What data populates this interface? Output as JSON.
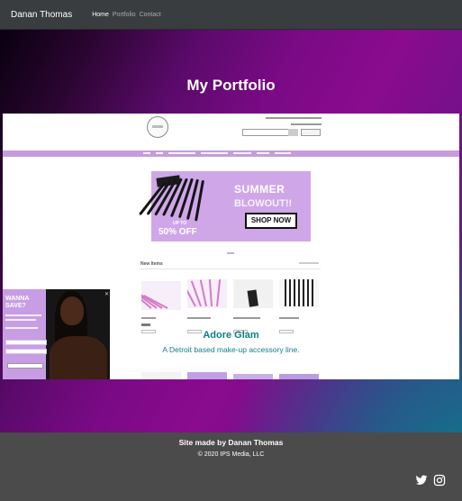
{
  "navbar": {
    "brand": "Danan Thomas",
    "links": [
      {
        "label": "Home",
        "active": true
      },
      {
        "label": "Portfolio",
        "active": false
      },
      {
        "label": "Contact",
        "active": false
      }
    ]
  },
  "hero": {
    "title": "My Portfolio"
  },
  "project": {
    "title": "Adore Glam",
    "description": "A Detroit based make-up accessory line.",
    "screenshot": {
      "banner": {
        "headline": "SUMMER",
        "subheadline": "BLOWOUT!!",
        "discount_prefix": "UP TO",
        "discount": "50% OFF",
        "button": "SHOP NOW"
      },
      "section_title": "New Items",
      "popup_title": "WANNA SAVE?"
    }
  },
  "footer": {
    "made_by": "Site made by Danan Thomas",
    "copyright": "© 2020 IPS Media, LLC",
    "social_icons": [
      "twitter-icon",
      "instagram-icon"
    ]
  },
  "colors": {
    "nav_bg": "#3a3d40",
    "hero_purple": "#8a0b8e",
    "accent_teal": "#0b7f86",
    "footer_bg": "#4b4b4b",
    "site_lavender": "#c69cdc"
  }
}
